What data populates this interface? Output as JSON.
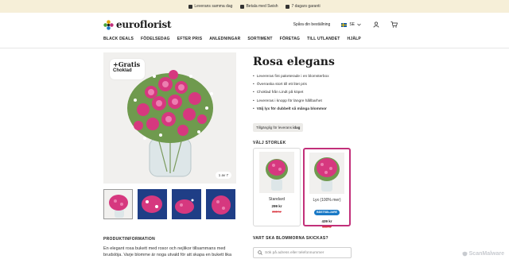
{
  "topbar": {
    "items": [
      "Leverans samma dag",
      "Betala med Swish",
      "7 dagars garanti"
    ]
  },
  "header": {
    "logo_text": "euroflorist",
    "track_order": "Spåra din beställning",
    "language": "SE"
  },
  "nav": {
    "items": [
      "BLACK DEALS",
      "FÖDELSEDAG",
      "EFTER PRIS",
      "ANLEDNINGAR",
      "SORTIMENT",
      "FÖRETAG",
      "TILL UTLANDET",
      "HJÄLP"
    ]
  },
  "gallery": {
    "badge_title": "+Gratis",
    "badge_sub": "Choklad",
    "counter": "1 av 7"
  },
  "product": {
    "title": "Rosa elegans",
    "features": [
      "Levereras fint paketerade i en blomsterbox",
      "Överraska stort till ett litet pris",
      "Choklad från Lindt på köpet",
      "Levereras i knopp för längre hållbarhet",
      "Välj lyx för dubbelt så många blommor"
    ],
    "availability_prefix": "Tillgänglig för leverans",
    "availability_day": "idag"
  },
  "sizes": {
    "title": "VÄLJ STORLEK",
    "options": [
      {
        "name": "Standard",
        "price": "299 kr",
        "old_price": "399 kr",
        "badge": ""
      },
      {
        "name": "Lyx (100% mer)",
        "price": "439 kr",
        "old_price": "539 kr",
        "badge": "BÄSTSÄLJARE"
      }
    ]
  },
  "info": {
    "title": "PRODUKTINFORMATION",
    "text": "En elegant rosa bukett med rosor och nejlikor tillsammans med brudslöja. Varje blomme är noga utvald för att skapa en bukett lika"
  },
  "delivery": {
    "title": "VART SKA BLOMMORNA SKICKAS?",
    "placeholder": "Sök på adress eller telefonnummer"
  },
  "watermark": "ScanMalware",
  "colors": {
    "topbar_bg": "#f6efd8",
    "accent_pink": "#c2307a",
    "badge_blue": "#1979c6",
    "old_price_red": "#d9343e"
  }
}
